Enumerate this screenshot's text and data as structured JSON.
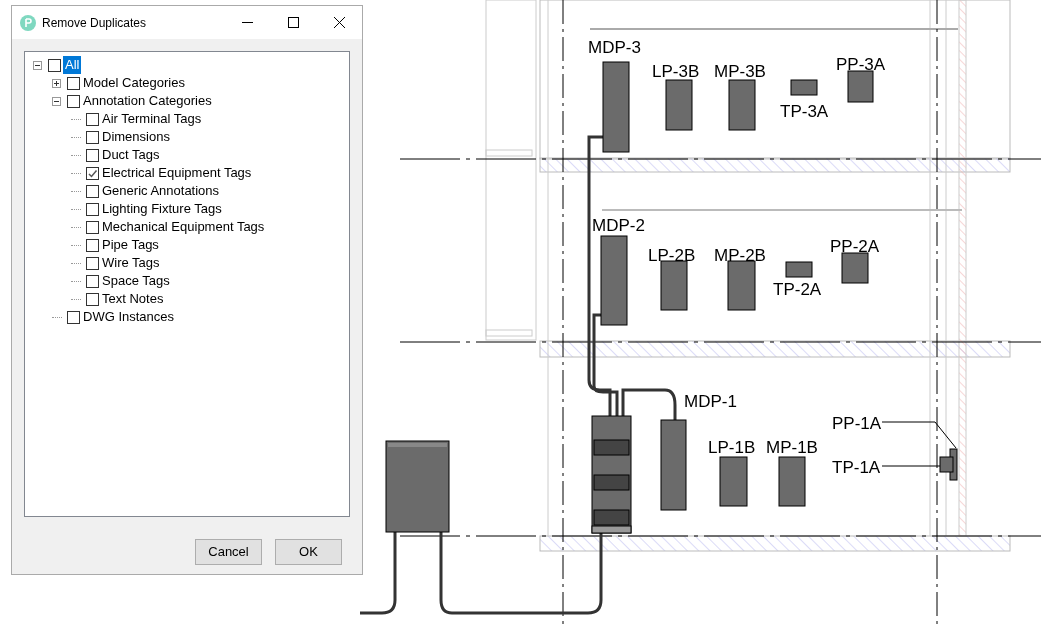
{
  "window": {
    "title": "Remove Duplicates"
  },
  "tree": [
    {
      "label": "All",
      "checked": false,
      "selected": true,
      "expanded": true,
      "children": [
        {
          "label": "Model Categories",
          "checked": false,
          "selected": false,
          "expanded": false
        },
        {
          "label": "Annotation Categories",
          "checked": false,
          "selected": false,
          "expanded": true,
          "children": [
            {
              "label": "Air Terminal Tags",
              "checked": false,
              "selected": false
            },
            {
              "label": "Dimensions",
              "checked": false,
              "selected": false
            },
            {
              "label": "Duct Tags",
              "checked": false,
              "selected": false
            },
            {
              "label": "Electrical Equipment Tags",
              "checked": true,
              "selected": false
            },
            {
              "label": "Generic Annotations",
              "checked": false,
              "selected": false
            },
            {
              "label": "Lighting Fixture Tags",
              "checked": false,
              "selected": false
            },
            {
              "label": "Mechanical Equipment Tags",
              "checked": false,
              "selected": false
            },
            {
              "label": "Pipe Tags",
              "checked": false,
              "selected": false
            },
            {
              "label": "Wire Tags",
              "checked": false,
              "selected": false
            },
            {
              "label": "Space Tags",
              "checked": false,
              "selected": false
            },
            {
              "label": "Text Notes",
              "checked": false,
              "selected": false
            }
          ]
        },
        {
          "label": "DWG Instances",
          "checked": false,
          "selected": false
        }
      ]
    }
  ],
  "buttons": [
    "Cancel",
    "OK"
  ],
  "drawing": {
    "labels": [
      "MDP-3",
      "LP-3B",
      "MP-3B",
      "TP-3A",
      "PP-3A",
      "MDP-2",
      "LP-2B",
      "MP-2B",
      "TP-2A",
      "PP-2A",
      "MDP-1",
      "LP-1B",
      "MP-1B",
      "PP-1A",
      "TP-1A"
    ]
  }
}
